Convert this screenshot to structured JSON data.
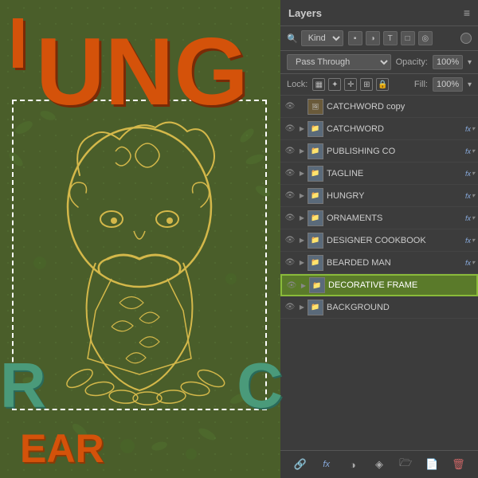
{
  "panel": {
    "title": "Layers",
    "menu_icon": "≡",
    "filter": {
      "kind_label": "Kind",
      "kind_placeholder": "Kind",
      "filter_icons": [
        "pixel-icon",
        "adjustment-icon",
        "type-icon",
        "shape-icon",
        "smart-icon"
      ]
    },
    "blend": {
      "mode": "Pass Through",
      "opacity_label": "Opacity:",
      "opacity_value": "100%"
    },
    "lock": {
      "label": "Lock:",
      "icons": [
        "checkerboard-icon",
        "move-icon",
        "artboard-icon",
        "lock-icon"
      ],
      "fill_label": "Fill:",
      "fill_value": "100%"
    },
    "layers": [
      {
        "id": "catchword-copy",
        "visible": true,
        "expandable": false,
        "type": "img",
        "name": "CATCHWORD copy",
        "has_fx": false,
        "thumb_color": "#6a5a3a",
        "selected": false
      },
      {
        "id": "catchword",
        "visible": true,
        "expandable": true,
        "type": "folder",
        "name": "CATCHWORD",
        "has_fx": true,
        "thumb_color": "#5a6a7a",
        "selected": false
      },
      {
        "id": "publishing-co",
        "visible": true,
        "expandable": true,
        "type": "folder",
        "name": "PUBLISHING CO",
        "has_fx": true,
        "thumb_color": "#5a6a7a",
        "selected": false
      },
      {
        "id": "tagline",
        "visible": true,
        "expandable": true,
        "type": "folder",
        "name": "TAGLINE",
        "has_fx": true,
        "thumb_color": "#5a6a7a",
        "selected": false
      },
      {
        "id": "hungry",
        "visible": true,
        "expandable": true,
        "type": "folder",
        "name": "HUNGRY",
        "has_fx": true,
        "thumb_color": "#5a6a7a",
        "selected": false
      },
      {
        "id": "ornaments",
        "visible": true,
        "expandable": true,
        "type": "folder",
        "name": "ORNAMENTS",
        "has_fx": true,
        "thumb_color": "#5a6a7a",
        "selected": false
      },
      {
        "id": "designer-cookbook",
        "visible": true,
        "expandable": true,
        "type": "folder",
        "name": "DESIGNER COOKBOOK",
        "has_fx": true,
        "thumb_color": "#5a6a7a",
        "selected": false
      },
      {
        "id": "bearded-man",
        "visible": true,
        "expandable": true,
        "type": "folder",
        "name": "BEARDED MAN",
        "has_fx": true,
        "thumb_color": "#5a6a7a",
        "selected": false
      },
      {
        "id": "decorative-frame",
        "visible": true,
        "expandable": true,
        "type": "folder",
        "name": "DECORATIVE FRAME",
        "has_fx": false,
        "thumb_color": "#5a6a7a",
        "selected": true
      },
      {
        "id": "background",
        "visible": true,
        "expandable": true,
        "type": "folder",
        "name": "BACKGROUND",
        "has_fx": false,
        "thumb_color": "#5a6a7a",
        "selected": false
      }
    ],
    "footer": {
      "link_icon": "🔗",
      "fx_icon": "fx",
      "adjustment_icon": "◑",
      "folder_icon": "🗁",
      "new_layer_icon": "📄",
      "delete_icon": "🗑"
    }
  },
  "artwork": {
    "text_ung": "UNG",
    "text_i_top": "I",
    "text_r": "R",
    "text_c": "C",
    "text_ear": "EAR"
  }
}
